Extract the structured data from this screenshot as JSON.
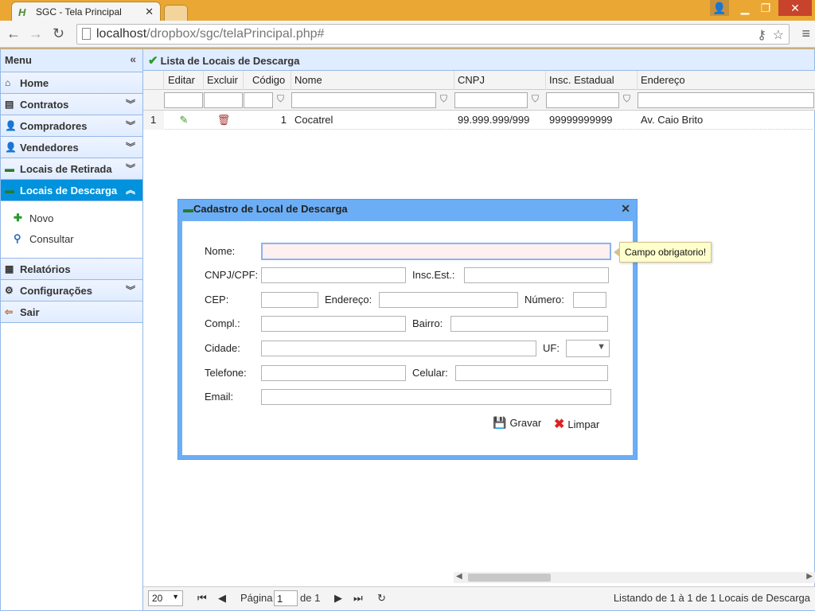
{
  "browser": {
    "tab_title": "SGC - Tela Principal",
    "url_host": "localhost",
    "url_path": "/dropbox/sgc/telaPrincipal.php#"
  },
  "sidebar": {
    "title": "Menu",
    "items": [
      {
        "label": "Home",
        "icon": "home-icon"
      },
      {
        "label": "Contratos",
        "icon": "contract-icon"
      },
      {
        "label": "Compradores",
        "icon": "user-icon"
      },
      {
        "label": "Vendedores",
        "icon": "user-red-icon"
      },
      {
        "label": "Locais de Retirada",
        "icon": "truck-icon"
      },
      {
        "label": "Locais de Descarga",
        "icon": "truck-icon"
      },
      {
        "label": "Relatórios",
        "icon": "report-icon"
      },
      {
        "label": "Configurações",
        "icon": "gear-icon"
      },
      {
        "label": "Sair",
        "icon": "exit-icon"
      }
    ],
    "sub_items": [
      {
        "label": "Novo",
        "icon": "add-icon"
      },
      {
        "label": "Consultar",
        "icon": "search-icon"
      }
    ]
  },
  "main": {
    "title": "Lista de Locais de Descarga",
    "columns": [
      "Editar",
      "Excluir",
      "Código",
      "Nome",
      "CNPJ",
      "Insc. Estadual",
      "Endereço"
    ],
    "rows": [
      {
        "n": "1",
        "codigo": "1",
        "nome": "Cocatrel",
        "cnpj": "99.999.999/999",
        "insc": "99999999999",
        "endereco": "Av. Caio Brito"
      }
    ],
    "pager": {
      "page_size": "20",
      "page_label": "Página",
      "page_value": "1",
      "of_label": "de 1",
      "status": "Listando de 1 à 1 de 1 Locais de Descarga"
    }
  },
  "dialog": {
    "title": "Cadastro de Local de Descarga",
    "labels": {
      "nome": "Nome:",
      "cnpj": "CNPJ/CPF:",
      "insc": "Insc.Est.:",
      "cep": "CEP:",
      "endereco": "Endereço:",
      "numero": "Número:",
      "compl": "Compl.:",
      "bairro": "Bairro:",
      "cidade": "Cidade:",
      "uf": "UF:",
      "telefone": "Telefone:",
      "celular": "Celular:",
      "email": "Email:"
    },
    "tooltip": "Campo obrigatorio!",
    "save_label": "Gravar",
    "clear_label": "Limpar"
  }
}
